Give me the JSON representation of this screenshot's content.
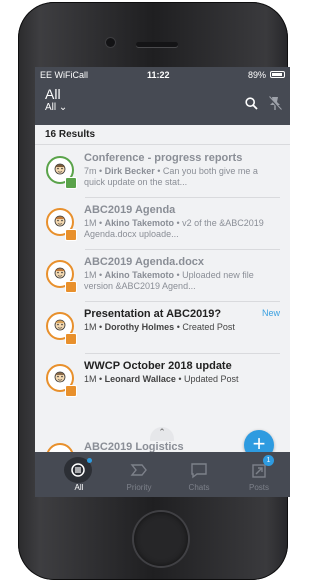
{
  "status": {
    "carrier": "EE WiFiCall",
    "time": "11:22",
    "battery": "89%"
  },
  "header": {
    "title": "All",
    "subtitle": "All ⌄"
  },
  "results": "16 Results",
  "items": [
    {
      "title": "Conference - progress reports",
      "time": "7m",
      "author": "Dirk Becker",
      "text": "Can you both give me a quick update on the stat...",
      "avatar_color": "#5aa34a",
      "unread": false
    },
    {
      "title": "ABC2019 Agenda",
      "time": "1M",
      "author": "Akino Takemoto",
      "text": "v2 of the &ABC2019 Agenda.docx  uploade...",
      "avatar_color": "#e8902c",
      "unread": false
    },
    {
      "title": "ABC2019 Agenda.docx",
      "time": "1M",
      "author": "Akino Takemoto",
      "text": "Uploaded new file version  &ABC2019 Agend...",
      "avatar_color": "#e8902c",
      "unread": false
    },
    {
      "title": "Presentation at ABC2019?",
      "time": "1M",
      "author": "Dorothy Holmes",
      "text": "Created Post",
      "avatar_color": "#e8902c",
      "unread": true,
      "tag": "New"
    },
    {
      "title": "WWCP October 2018 update",
      "time": "1M",
      "author": "Leonard Wallace",
      "text": "Updated Post",
      "avatar_color": "#e8902c",
      "unread": true
    }
  ],
  "peek_title": "ABC2019 Logistics",
  "fab_label": "+",
  "tabs": [
    {
      "label": "All",
      "icon": "all-feed-icon",
      "active": true
    },
    {
      "label": "Priority",
      "icon": "priority-icon",
      "active": false
    },
    {
      "label": "Chats",
      "icon": "chat-bubble-icon",
      "active": false
    },
    {
      "label": "Posts",
      "icon": "posts-icon",
      "active": false,
      "badge": "1"
    }
  ],
  "colors": {
    "header": "#464a53",
    "accent": "#2e9be0",
    "green": "#5aa34a",
    "orange": "#e8902c"
  }
}
